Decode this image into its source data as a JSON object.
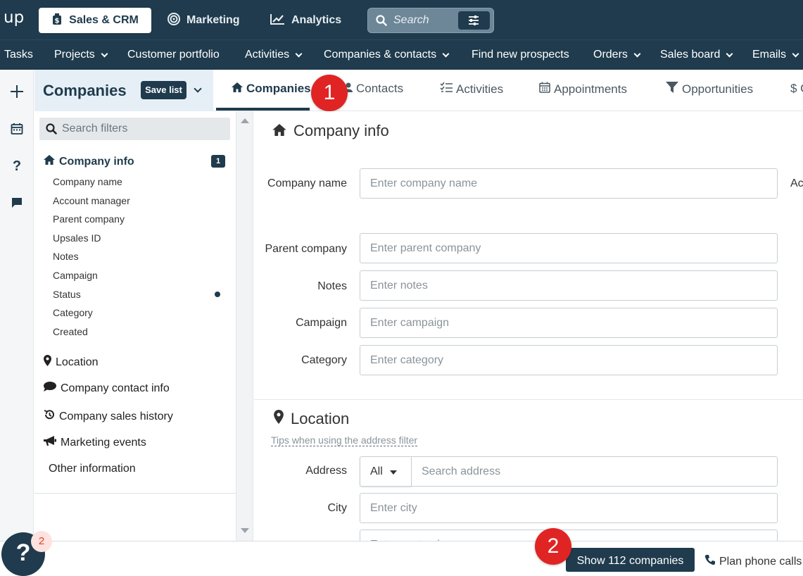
{
  "app": {
    "logo": "up"
  },
  "topnav": {
    "tabs": [
      {
        "label": "Sales & CRM",
        "icon": "dollar-bag-icon",
        "active": true
      },
      {
        "label": "Marketing",
        "icon": "target-icon"
      },
      {
        "label": "Analytics",
        "icon": "chart-line-icon"
      }
    ],
    "search_placeholder": "Search"
  },
  "mainnav": {
    "items": [
      {
        "label": "Tasks",
        "dropdown": false
      },
      {
        "label": "Projects",
        "dropdown": true
      },
      {
        "label": "Customer portfolio",
        "dropdown": false
      },
      {
        "label": "Activities",
        "dropdown": true
      },
      {
        "label": "Companies & contacts",
        "dropdown": true
      },
      {
        "label": "Find new prospects",
        "dropdown": false
      },
      {
        "label": "Orders",
        "dropdown": true
      },
      {
        "label": "Sales board",
        "dropdown": true
      },
      {
        "label": "Emails",
        "dropdown": true
      }
    ]
  },
  "list_header": {
    "title": "Companies",
    "save_list": "Save list"
  },
  "subtabs": [
    {
      "label": "Companies",
      "icon": "home-icon",
      "active": true
    },
    {
      "label": "Contacts",
      "icon": "person-icon"
    },
    {
      "label": "Activities",
      "icon": "list-check-icon"
    },
    {
      "label": "Appointments",
      "icon": "calendar-icon"
    },
    {
      "label": "Opportunities",
      "icon": "funnel-icon"
    },
    {
      "label": "$ C",
      "icon": ""
    }
  ],
  "markers": {
    "one": "1",
    "two": "2"
  },
  "filters": {
    "search_placeholder": "Search filters",
    "company_info": {
      "label": "Company info",
      "count": "1",
      "items": [
        "Company name",
        "Account manager",
        "Parent company",
        "Upsales ID",
        "Notes",
        "Campaign",
        "Status",
        "Category",
        "Created"
      ]
    },
    "sections": [
      "Location",
      "Company contact info",
      "Company sales history",
      "Marketing events",
      "Other information"
    ]
  },
  "company_info_form": {
    "title": "Company info",
    "fields": [
      {
        "label": "Company name",
        "placeholder": "Enter company name"
      },
      {
        "label": "Parent company",
        "placeholder": "Enter parent company"
      },
      {
        "label": "Notes",
        "placeholder": "Enter notes"
      },
      {
        "label": "Campaign",
        "placeholder": "Enter campaign"
      },
      {
        "label": "Category",
        "placeholder": "Enter category"
      }
    ],
    "cut_label": "Ac"
  },
  "location_form": {
    "title": "Location",
    "tips": "Tips when using the address filter",
    "address_label": "Address",
    "address_scope": "All",
    "address_placeholder": "Search address",
    "city_label": "City",
    "city_placeholder": "Enter city",
    "next_placeholder": "Enter postcode"
  },
  "bottom": {
    "help": "?",
    "help_count": "2",
    "show_button": "Show 112 companies",
    "plan_calls": "Plan phone calls"
  }
}
